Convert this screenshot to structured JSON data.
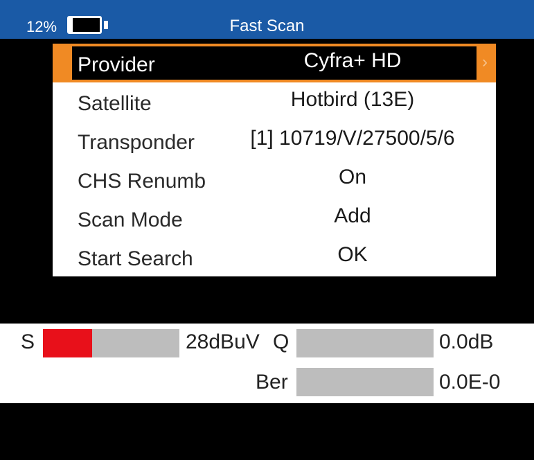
{
  "header": {
    "battery_percent": "12%",
    "battery_level": 0.12,
    "title": "Fast Scan"
  },
  "menu": {
    "items": [
      {
        "label": "Provider",
        "value": "Cyfra+ HD",
        "selected": true
      },
      {
        "label": "Satellite",
        "value": "Hotbird (13E)",
        "selected": false
      },
      {
        "label": "Transponder",
        "value": "[1] 10719/V/27500/5/6",
        "selected": false
      },
      {
        "label": "CHS Renumb",
        "value": "On",
        "selected": false
      },
      {
        "label": "Scan Mode",
        "value": "Add",
        "selected": false
      },
      {
        "label": "Start Search",
        "value": "OK",
        "selected": false
      }
    ],
    "chevron_icon": "chevron-right-icon"
  },
  "meters": {
    "s_label": "S",
    "s_value": "28dBuV",
    "s_level": 0.36,
    "q_label": "Q",
    "q_value": "0.0dB",
    "q_level": 0,
    "ber_label": "Ber",
    "ber_value": "0.0E-0",
    "ber_level": 0
  },
  "colors": {
    "header": "#1a5aa6",
    "highlight": "#f08a24",
    "signal_fill": "#e8101a",
    "bar_track": "#bdbdbd"
  }
}
